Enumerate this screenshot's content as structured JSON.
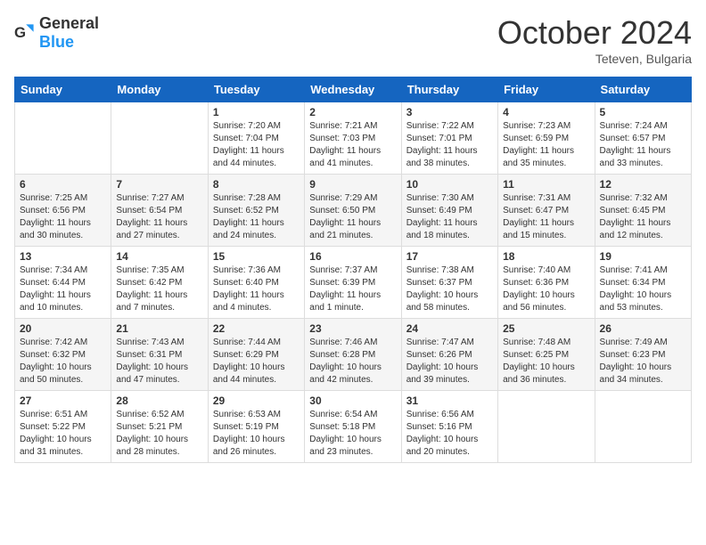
{
  "header": {
    "logo_general": "General",
    "logo_blue": "Blue",
    "month_title": "October 2024",
    "location": "Teteven, Bulgaria"
  },
  "weekdays": [
    "Sunday",
    "Monday",
    "Tuesday",
    "Wednesday",
    "Thursday",
    "Friday",
    "Saturday"
  ],
  "weeks": [
    [
      {
        "day": null,
        "sunrise": null,
        "sunset": null,
        "daylight": null
      },
      {
        "day": null,
        "sunrise": null,
        "sunset": null,
        "daylight": null
      },
      {
        "day": "1",
        "sunrise": "Sunrise: 7:20 AM",
        "sunset": "Sunset: 7:04 PM",
        "daylight": "Daylight: 11 hours and 44 minutes."
      },
      {
        "day": "2",
        "sunrise": "Sunrise: 7:21 AM",
        "sunset": "Sunset: 7:03 PM",
        "daylight": "Daylight: 11 hours and 41 minutes."
      },
      {
        "day": "3",
        "sunrise": "Sunrise: 7:22 AM",
        "sunset": "Sunset: 7:01 PM",
        "daylight": "Daylight: 11 hours and 38 minutes."
      },
      {
        "day": "4",
        "sunrise": "Sunrise: 7:23 AM",
        "sunset": "Sunset: 6:59 PM",
        "daylight": "Daylight: 11 hours and 35 minutes."
      },
      {
        "day": "5",
        "sunrise": "Sunrise: 7:24 AM",
        "sunset": "Sunset: 6:57 PM",
        "daylight": "Daylight: 11 hours and 33 minutes."
      }
    ],
    [
      {
        "day": "6",
        "sunrise": "Sunrise: 7:25 AM",
        "sunset": "Sunset: 6:56 PM",
        "daylight": "Daylight: 11 hours and 30 minutes."
      },
      {
        "day": "7",
        "sunrise": "Sunrise: 7:27 AM",
        "sunset": "Sunset: 6:54 PM",
        "daylight": "Daylight: 11 hours and 27 minutes."
      },
      {
        "day": "8",
        "sunrise": "Sunrise: 7:28 AM",
        "sunset": "Sunset: 6:52 PM",
        "daylight": "Daylight: 11 hours and 24 minutes."
      },
      {
        "day": "9",
        "sunrise": "Sunrise: 7:29 AM",
        "sunset": "Sunset: 6:50 PM",
        "daylight": "Daylight: 11 hours and 21 minutes."
      },
      {
        "day": "10",
        "sunrise": "Sunrise: 7:30 AM",
        "sunset": "Sunset: 6:49 PM",
        "daylight": "Daylight: 11 hours and 18 minutes."
      },
      {
        "day": "11",
        "sunrise": "Sunrise: 7:31 AM",
        "sunset": "Sunset: 6:47 PM",
        "daylight": "Daylight: 11 hours and 15 minutes."
      },
      {
        "day": "12",
        "sunrise": "Sunrise: 7:32 AM",
        "sunset": "Sunset: 6:45 PM",
        "daylight": "Daylight: 11 hours and 12 minutes."
      }
    ],
    [
      {
        "day": "13",
        "sunrise": "Sunrise: 7:34 AM",
        "sunset": "Sunset: 6:44 PM",
        "daylight": "Daylight: 11 hours and 10 minutes."
      },
      {
        "day": "14",
        "sunrise": "Sunrise: 7:35 AM",
        "sunset": "Sunset: 6:42 PM",
        "daylight": "Daylight: 11 hours and 7 minutes."
      },
      {
        "day": "15",
        "sunrise": "Sunrise: 7:36 AM",
        "sunset": "Sunset: 6:40 PM",
        "daylight": "Daylight: 11 hours and 4 minutes."
      },
      {
        "day": "16",
        "sunrise": "Sunrise: 7:37 AM",
        "sunset": "Sunset: 6:39 PM",
        "daylight": "Daylight: 11 hours and 1 minute."
      },
      {
        "day": "17",
        "sunrise": "Sunrise: 7:38 AM",
        "sunset": "Sunset: 6:37 PM",
        "daylight": "Daylight: 10 hours and 58 minutes."
      },
      {
        "day": "18",
        "sunrise": "Sunrise: 7:40 AM",
        "sunset": "Sunset: 6:36 PM",
        "daylight": "Daylight: 10 hours and 56 minutes."
      },
      {
        "day": "19",
        "sunrise": "Sunrise: 7:41 AM",
        "sunset": "Sunset: 6:34 PM",
        "daylight": "Daylight: 10 hours and 53 minutes."
      }
    ],
    [
      {
        "day": "20",
        "sunrise": "Sunrise: 7:42 AM",
        "sunset": "Sunset: 6:32 PM",
        "daylight": "Daylight: 10 hours and 50 minutes."
      },
      {
        "day": "21",
        "sunrise": "Sunrise: 7:43 AM",
        "sunset": "Sunset: 6:31 PM",
        "daylight": "Daylight: 10 hours and 47 minutes."
      },
      {
        "day": "22",
        "sunrise": "Sunrise: 7:44 AM",
        "sunset": "Sunset: 6:29 PM",
        "daylight": "Daylight: 10 hours and 44 minutes."
      },
      {
        "day": "23",
        "sunrise": "Sunrise: 7:46 AM",
        "sunset": "Sunset: 6:28 PM",
        "daylight": "Daylight: 10 hours and 42 minutes."
      },
      {
        "day": "24",
        "sunrise": "Sunrise: 7:47 AM",
        "sunset": "Sunset: 6:26 PM",
        "daylight": "Daylight: 10 hours and 39 minutes."
      },
      {
        "day": "25",
        "sunrise": "Sunrise: 7:48 AM",
        "sunset": "Sunset: 6:25 PM",
        "daylight": "Daylight: 10 hours and 36 minutes."
      },
      {
        "day": "26",
        "sunrise": "Sunrise: 7:49 AM",
        "sunset": "Sunset: 6:23 PM",
        "daylight": "Daylight: 10 hours and 34 minutes."
      }
    ],
    [
      {
        "day": "27",
        "sunrise": "Sunrise: 6:51 AM",
        "sunset": "Sunset: 5:22 PM",
        "daylight": "Daylight: 10 hours and 31 minutes."
      },
      {
        "day": "28",
        "sunrise": "Sunrise: 6:52 AM",
        "sunset": "Sunset: 5:21 PM",
        "daylight": "Daylight: 10 hours and 28 minutes."
      },
      {
        "day": "29",
        "sunrise": "Sunrise: 6:53 AM",
        "sunset": "Sunset: 5:19 PM",
        "daylight": "Daylight: 10 hours and 26 minutes."
      },
      {
        "day": "30",
        "sunrise": "Sunrise: 6:54 AM",
        "sunset": "Sunset: 5:18 PM",
        "daylight": "Daylight: 10 hours and 23 minutes."
      },
      {
        "day": "31",
        "sunrise": "Sunrise: 6:56 AM",
        "sunset": "Sunset: 5:16 PM",
        "daylight": "Daylight: 10 hours and 20 minutes."
      },
      {
        "day": null,
        "sunrise": null,
        "sunset": null,
        "daylight": null
      },
      {
        "day": null,
        "sunrise": null,
        "sunset": null,
        "daylight": null
      }
    ]
  ]
}
